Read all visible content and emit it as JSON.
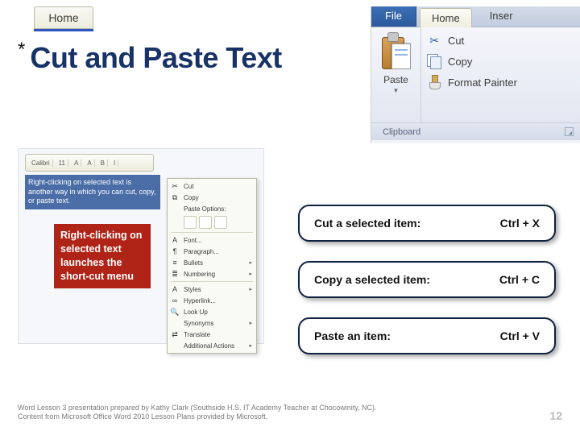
{
  "homeTab": "Home",
  "title": {
    "asterisk": "*",
    "text": "Cut and Paste Text"
  },
  "ribbon": {
    "tabs": {
      "file": "File",
      "home": "Home",
      "insert": "Inser"
    },
    "paste": "Paste",
    "actions": {
      "cut": "Cut",
      "copy": "Copy",
      "formatPainter": "Format Painter"
    },
    "group": "Clipboard"
  },
  "ctx": {
    "miniToolbar": [
      "Calibri",
      "11",
      "A",
      "A",
      "B",
      "I"
    ],
    "docText": "Right-clicking on selected text is another way in which you can cut, copy, or paste text.",
    "items": [
      "Cut",
      "Copy",
      "Paste Options:",
      "Font...",
      "Paragraph...",
      "Bullets",
      "Numbering",
      "Styles",
      "Hyperlink...",
      "Look Up",
      "Synonyms",
      "Translate",
      "Additional Actions"
    ]
  },
  "callout": "Right-clicking on selected text launches the short-cut menu",
  "shortcuts": [
    {
      "label": "Cut a selected item:",
      "keys": "Ctrl + X"
    },
    {
      "label": "Copy a selected item:",
      "keys": "Ctrl + C"
    },
    {
      "label": "Paste an item:",
      "keys": "Ctrl + V"
    }
  ],
  "footer": {
    "credit": "Word Lesson 3 presentation prepared by Kathy Clark (Southside H.S. IT Academy Teacher at Chocowinity, NC). Content from Microsoft Office Word 2010 Lesson Plans provided by Microsoft.",
    "page": "12"
  }
}
